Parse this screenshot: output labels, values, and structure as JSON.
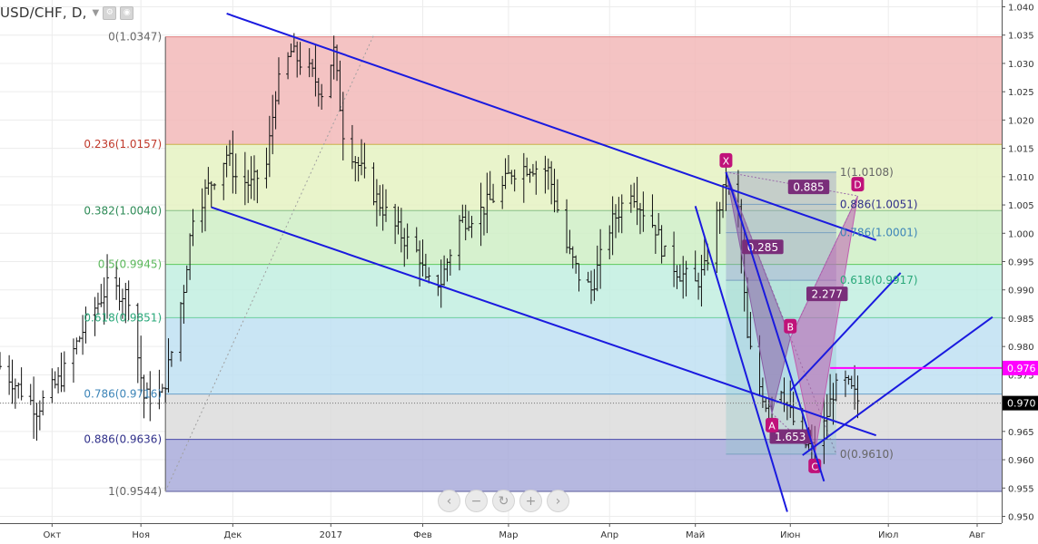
{
  "header": {
    "symbol_label": "USD/CHF, D,",
    "caret_icon": "caret-down-icon",
    "buttons": [
      {
        "name": "settings-button",
        "icon": "gear-icon"
      },
      {
        "name": "hide-button",
        "icon": "eye-icon"
      }
    ]
  },
  "nav_controls": [
    {
      "name": "scroll-left-button",
      "icon": "chevron-left-icon",
      "glyph": "‹"
    },
    {
      "name": "zoom-out-button",
      "icon": "minus-icon",
      "glyph": "−"
    },
    {
      "name": "reset-button",
      "icon": "reset-icon",
      "glyph": "↻"
    },
    {
      "name": "zoom-in-button",
      "icon": "plus-icon",
      "glyph": "+"
    },
    {
      "name": "scroll-right-button",
      "icon": "chevron-right-icon",
      "glyph": "›"
    }
  ],
  "chart_data": {
    "type": "ohlc",
    "symbol": "USD/CHF",
    "timeframe": "D",
    "yaxis": {
      "range": [
        0.9488,
        1.0412
      ],
      "ticks": [
        "0.950",
        "0.955",
        "0.960",
        "0.965",
        "0.970",
        "0.975",
        "0.980",
        "0.985",
        "0.990",
        "0.995",
        "1.000",
        "1.005",
        "1.010",
        "1.015",
        "1.020",
        "1.025",
        "1.030",
        "1.035",
        "1.040"
      ]
    },
    "xaxis": {
      "start": "2016-09-16",
      "end": "2017-08-09",
      "ticks": [
        {
          "label": "Окт",
          "date": "2016-10-03"
        },
        {
          "label": "Ноя",
          "date": "2016-11-01"
        },
        {
          "label": "Дек",
          "date": "2016-12-01"
        },
        {
          "label": "2017",
          "date": "2017-01-02"
        },
        {
          "label": "Фев",
          "date": "2017-02-01"
        },
        {
          "label": "Мар",
          "date": "2017-03-01"
        },
        {
          "label": "Апр",
          "date": "2017-04-03"
        },
        {
          "label": "Май",
          "date": "2017-05-01"
        },
        {
          "label": "Июн",
          "date": "2017-06-01"
        },
        {
          "label": "Июл",
          "date": "2017-07-03"
        },
        {
          "label": "Авг",
          "date": "2017-08-01"
        }
      ]
    },
    "price_path": [
      [
        "2016-09-16",
        0.9765
      ],
      [
        "2016-09-28",
        0.969
      ],
      [
        "2016-10-06",
        0.9745
      ],
      [
        "2016-10-14",
        0.984
      ],
      [
        "2016-10-21",
        0.9905
      ],
      [
        "2016-10-28",
        0.989
      ],
      [
        "2016-11-02",
        0.971
      ],
      [
        "2016-11-08",
        0.9715
      ],
      [
        "2016-11-11",
        0.979
      ],
      [
        "2016-11-15",
        0.9905
      ],
      [
        "2016-11-18",
        1.0035
      ],
      [
        "2016-11-24",
        1.009
      ],
      [
        "2016-11-29",
        1.014
      ],
      [
        "2016-12-02",
        1.01
      ],
      [
        "2016-12-07",
        1.0085
      ],
      [
        "2016-12-12",
        1.012
      ],
      [
        "2016-12-15",
        1.025
      ],
      [
        "2016-12-20",
        1.032
      ],
      [
        "2016-12-27",
        1.028
      ],
      [
        "2016-12-30",
        1.025
      ],
      [
        "2017-01-03",
        1.032
      ],
      [
        "2017-01-06",
        1.018
      ],
      [
        "2017-01-10",
        1.013
      ],
      [
        "2017-01-16",
        1.007
      ],
      [
        "2017-01-23",
        1.001
      ],
      [
        "2017-01-31",
        0.996
      ],
      [
        "2017-02-02",
        0.991
      ],
      [
        "2017-02-07",
        0.9915
      ],
      [
        "2017-02-13",
        1.002
      ],
      [
        "2017-02-20",
        1.004
      ],
      [
        "2017-02-27",
        1.008
      ],
      [
        "2017-03-02",
        1.011
      ],
      [
        "2017-03-08",
        1.012
      ],
      [
        "2017-03-14",
        1.011
      ],
      [
        "2017-03-20",
        0.9975
      ],
      [
        "2017-03-24",
        0.9925
      ],
      [
        "2017-03-28",
        0.99
      ],
      [
        "2017-04-03",
        1.001
      ],
      [
        "2017-04-10",
        1.008
      ],
      [
        "2017-04-14",
        1.004
      ],
      [
        "2017-04-18",
        1.001
      ],
      [
        "2017-04-21",
        0.996
      ],
      [
        "2017-04-26",
        0.993
      ],
      [
        "2017-05-01",
        0.991
      ],
      [
        "2017-05-04",
        0.9935
      ],
      [
        "2017-05-08",
        1.003
      ],
      [
        "2017-05-11",
        1.009
      ],
      [
        "2017-05-15",
        1.004
      ],
      [
        "2017-05-18",
        0.981
      ],
      [
        "2017-05-22",
        0.973
      ],
      [
        "2017-05-24",
        0.97
      ],
      [
        "2017-05-29",
        0.973
      ],
      [
        "2017-06-01",
        0.968
      ],
      [
        "2017-06-05",
        0.963
      ],
      [
        "2017-06-08",
        0.962
      ],
      [
        "2017-06-12",
        0.966
      ],
      [
        "2017-06-15",
        0.972
      ],
      [
        "2017-06-19",
        0.9735
      ],
      [
        "2017-06-23",
        0.9705
      ]
    ],
    "current_price_label": "0.970",
    "horizontal_level": {
      "value": 0.9762,
      "label": "0.976",
      "color": "#ff00ff"
    },
    "fibonacci": {
      "start_date": "2016-11-09",
      "end_date": "2017-08-09",
      "levels": [
        {
          "label": "0(1.0347)",
          "value": 1.0347,
          "fill": "#f2b8b8",
          "line": "#e08080",
          "text": "#666666"
        },
        {
          "label": "0.236(1.0157)",
          "value": 1.0157,
          "fill": "#e5f2c2",
          "line": "#c9b04a",
          "text": "#c0392b"
        },
        {
          "label": "0.382(1.0040)",
          "value": 1.004,
          "fill": "#cfefc6",
          "line": "#88c088",
          "text": "#2e8b57"
        },
        {
          "label": "0.5(0.9945)",
          "value": 0.9945,
          "fill": "#c2efe0",
          "line": "#5cc85c",
          "text": "#5cb85c"
        },
        {
          "label": "0.618(0.9851)",
          "value": 0.9851,
          "fill": "#c0e0f2",
          "line": "#6fcfa0",
          "text": "#2aa87a"
        },
        {
          "label": "0.786(0.9716)",
          "value": 0.9716,
          "fill": "#dcdcdc",
          "line": "#6aa0c8",
          "text": "#3d85b8"
        },
        {
          "label": "0.886(0.9636)",
          "value": 0.9636,
          "fill": "#a9abdb",
          "line": "#4848a8",
          "text": "#30308a"
        },
        {
          "label": "1(0.9544)",
          "value": 0.9544,
          "fill": null,
          "line": "#5a5a9a",
          "text": "#666666"
        }
      ]
    },
    "fib_box": {
      "start_date": "2017-05-11",
      "end_date": "2017-06-16",
      "levels": [
        {
          "label": "1(1.0108)",
          "value": 1.0108,
          "text": "#666666"
        },
        {
          "label": "0.886(1.0051)",
          "value": 1.0051,
          "text": "#30308a"
        },
        {
          "label": "0.786(1.0001)",
          "value": 1.0001,
          "text": "#3d85b8"
        },
        {
          "label": "0.618(0.9917)",
          "value": 0.9917,
          "text": "#2aa87a"
        },
        {
          "label": "0(0.9610)",
          "value": 0.961,
          "text": "#666666"
        }
      ]
    },
    "trendlines": [
      {
        "from": [
          "2016-11-29",
          1.0388
        ],
        "to": [
          "2017-06-29",
          0.9988
        ]
      },
      {
        "from": [
          "2016-11-24",
          1.0046
        ],
        "to": [
          "2017-06-29",
          0.9643
        ]
      },
      {
        "from": [
          "2017-05-01",
          1.0048
        ],
        "to": [
          "2017-05-31",
          0.9508
        ]
      },
      {
        "from": [
          "2017-05-11",
          1.0108
        ],
        "to": [
          "2017-06-12",
          0.9562
        ]
      },
      {
        "from": [
          "2017-06-01",
          0.9722
        ],
        "to": [
          "2017-07-07",
          0.993
        ]
      },
      {
        "from": [
          "2017-06-05",
          0.9608
        ],
        "to": [
          "2017-08-06",
          0.9852
        ]
      }
    ],
    "diagonal_trend": {
      "from": [
        "2016-11-09",
        0.9544
      ],
      "to": [
        "2017-01-16",
        1.035
      ]
    },
    "harmonic_pattern": {
      "points": [
        {
          "name": "X",
          "date": "2017-05-11",
          "value": 1.0108
        },
        {
          "name": "A",
          "date": "2017-05-26",
          "value": 0.9682
        },
        {
          "name": "B",
          "date": "2017-06-01",
          "value": 0.9815
        },
        {
          "name": "C",
          "date": "2017-06-09",
          "value": 0.961
        },
        {
          "name": "D",
          "date": "2017-06-23",
          "value": 1.0066
        }
      ],
      "ratios": [
        {
          "label": "0.285",
          "date": "2017-05-23",
          "value": 0.9976
        },
        {
          "label": "1.653",
          "date": "2017-06-01",
          "value": 0.9641
        },
        {
          "label": "2.277",
          "date": "2017-06-13",
          "value": 0.9893
        },
        {
          "label": "0.885",
          "date": "2017-06-07",
          "value": 1.0082
        }
      ],
      "fill_xab": "#8b5fa6",
      "fill_bcd": "#c05fb0",
      "label_color": "#7a2e7a",
      "point_color": "#c0127a"
    },
    "line_color": "#1a1adf"
  }
}
